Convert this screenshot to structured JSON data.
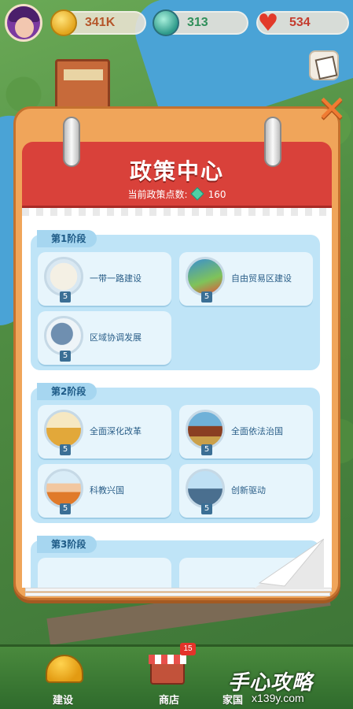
{
  "hud": {
    "coins": "341K",
    "gems": "313",
    "hearts": "534",
    "coin_icon": "coin-icon",
    "gem_icon": "gem-icon",
    "heart_icon": "heart-icon",
    "colors": {
      "coins": "#b5562a",
      "gems": "#2f8f5a",
      "hearts": "#c43c2e"
    }
  },
  "panel": {
    "title": "政策中心",
    "points_label": "当前政策点数:",
    "points_value": "160",
    "close_icon": "close-icon",
    "colors": {
      "frame": "#f0a55a",
      "header": "#d9413a",
      "stage_bg": "#bfe4f7"
    }
  },
  "stages": [
    {
      "label": "第1阶段",
      "policies": [
        {
          "name": "一带一路建设",
          "level": "5",
          "icon": "globe-route-icon"
        },
        {
          "name": "自由贸易区建设",
          "level": "5",
          "icon": "trade-globe-icon"
        },
        {
          "name": "区域协调发展",
          "level": "5",
          "icon": "map-region-icon"
        }
      ]
    },
    {
      "label": "第2阶段",
      "policies": [
        {
          "name": "全面深化改革",
          "level": "5",
          "icon": "reform-chart-icon"
        },
        {
          "name": "全面依法治国",
          "level": "5",
          "icon": "law-gavel-icon"
        },
        {
          "name": "科教兴国",
          "level": "5",
          "icon": "graduate-book-icon"
        },
        {
          "name": "创新驱动",
          "level": "5",
          "icon": "rocket-city-icon"
        }
      ]
    },
    {
      "label": "第3阶段",
      "policies": []
    }
  ],
  "nav": {
    "items": [
      {
        "label": "建设",
        "icon": "helmet-icon",
        "active": true
      },
      {
        "label": "商店",
        "icon": "shop-icon",
        "badge": "15"
      },
      {
        "label": "家国",
        "icon": "home-icon"
      }
    ]
  },
  "watermark": {
    "brand": "手心攻略",
    "domain": "x139y.com"
  }
}
